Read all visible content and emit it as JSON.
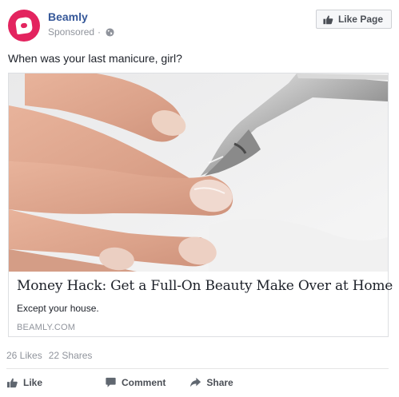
{
  "post": {
    "page_name": "Beamly",
    "sponsored_label": "Sponsored",
    "meta_separator": "·",
    "like_page_label": "Like Page",
    "text": "When was your last manicure, girl?"
  },
  "link": {
    "title": "Money Hack: Get a Full-On Beauty Make Over at Home",
    "description": "Except your house.",
    "domain": "BEAMLY.COM"
  },
  "stats": {
    "likes": "26 Likes",
    "shares": "22 Shares"
  },
  "actions": {
    "like": "Like",
    "comment": "Comment",
    "share": "Share"
  },
  "colors": {
    "brand": "#e3245f",
    "link_blue": "#365899",
    "muted": "#90949c"
  },
  "icons": {
    "avatar": "beamly-logo-icon",
    "audience": "globe-icon",
    "like": "thumbs-up-icon",
    "comment": "speech-bubble-icon",
    "share": "share-arrow-icon"
  }
}
